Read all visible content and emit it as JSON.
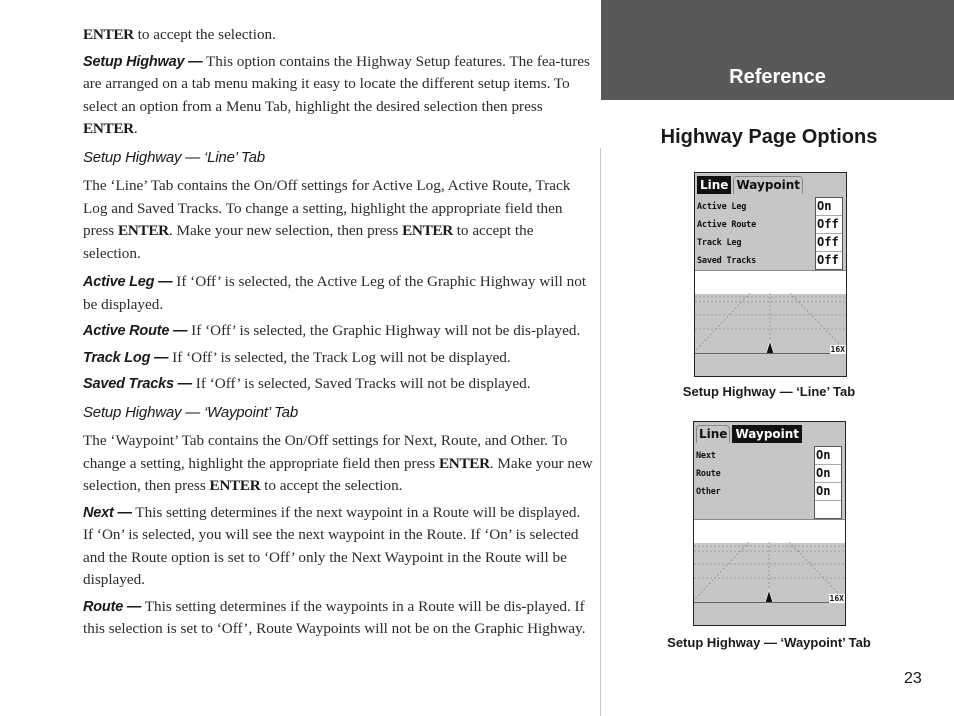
{
  "left_column": {
    "intro": {
      "key": "ENTER",
      "text": " to accept the selection."
    },
    "setup_highway": {
      "lead": "Setup Highway —",
      "text_1": " This option contains the Highway Setup features.  The fea-tures are arranged on a tab menu making it easy to locate the different setup items. To select an option from a Menu Tab, highlight the desired selection then press ",
      "key": "ENTER",
      "text_2": "."
    },
    "line_tab_heading": "Setup Highway — ‘Line’ Tab",
    "line_tab_body": {
      "text_1": "The ‘Line’ Tab contains the On/Off settings for Active Log, Active Route, Track Log and Saved Tracks.  To change a setting, highlight the appropriate field then press ",
      "key_1": "ENTER",
      "text_2": ".  Make your new selection, then press ",
      "key_2": "ENTER",
      "text_3": " to accept the selection."
    },
    "active_leg": {
      "lead": "Active Leg —",
      "text": " If ‘Off’ is selected, the Active Leg of the Graphic Highway will not be displayed."
    },
    "active_route": {
      "lead": "Active Route —",
      "text": " If ‘Off’ is selected, the Graphic Highway will not be dis-played."
    },
    "track_log": {
      "lead": "Track Log —",
      "text": " If ‘Off’ is selected, the Track Log will not be displayed."
    },
    "saved_tracks": {
      "lead": "Saved Tracks —",
      "text": " If ‘Off’ is selected, Saved Tracks will not be displayed."
    },
    "waypoint_tab_heading": "Setup Highway — ‘Waypoint’ Tab",
    "waypoint_tab_body": {
      "text_1": "The ‘Waypoint’ Tab contains the On/Off settings for Next, Route, and Other. To change a setting, highlight the appropriate field then press ",
      "key_1": "ENTER",
      "text_2": ".  Make your new selection, then press ",
      "key_2": "ENTER",
      "text_3": " to accept the selection."
    },
    "next": {
      "lead": "Next —",
      "text": " This setting determines if the next waypoint in a Route will be displayed.  If ‘On’ is selected, you will see the next waypoint in the Route.  If ‘On’ is selected and the Route option is set to ‘Off’ only the Next Waypoint in the Route will be displayed."
    },
    "route": {
      "lead": "Route —",
      "text": " This setting determines if the waypoints in a Route will be dis-played.  If this selection is set to ‘Off’, Route Waypoints will not be on the Graphic Highway."
    }
  },
  "right_column": {
    "section_label": "Reference",
    "title": "Highway Page Options",
    "screen_line": {
      "tabs": [
        {
          "label": "Line",
          "active": true
        },
        {
          "label": "Waypoint",
          "active": false
        }
      ],
      "rows": [
        {
          "label": "Active Leg",
          "value": "On"
        },
        {
          "label": "Active Route",
          "value": "Off"
        },
        {
          "label": "Track Leg",
          "value": "Off"
        },
        {
          "label": "Saved Tracks",
          "value": "Off"
        }
      ],
      "zoom": "16X",
      "caption": "Setup Highway — ‘Line’ Tab"
    },
    "screen_waypoint": {
      "tabs": [
        {
          "label": "Line",
          "active": false
        },
        {
          "label": "Waypoint",
          "active": true
        }
      ],
      "rows": [
        {
          "label": "Next",
          "value": "On"
        },
        {
          "label": "Route",
          "value": "On"
        },
        {
          "label": "Other",
          "value": "On"
        }
      ],
      "zoom": "16X",
      "caption": "Setup Highway — ‘Waypoint’ Tab"
    },
    "page_number": "23"
  },
  "colors": {
    "header_bg": "#5a5859",
    "screen_bg": "#c6c6c6",
    "text": "#2b2b2b"
  }
}
